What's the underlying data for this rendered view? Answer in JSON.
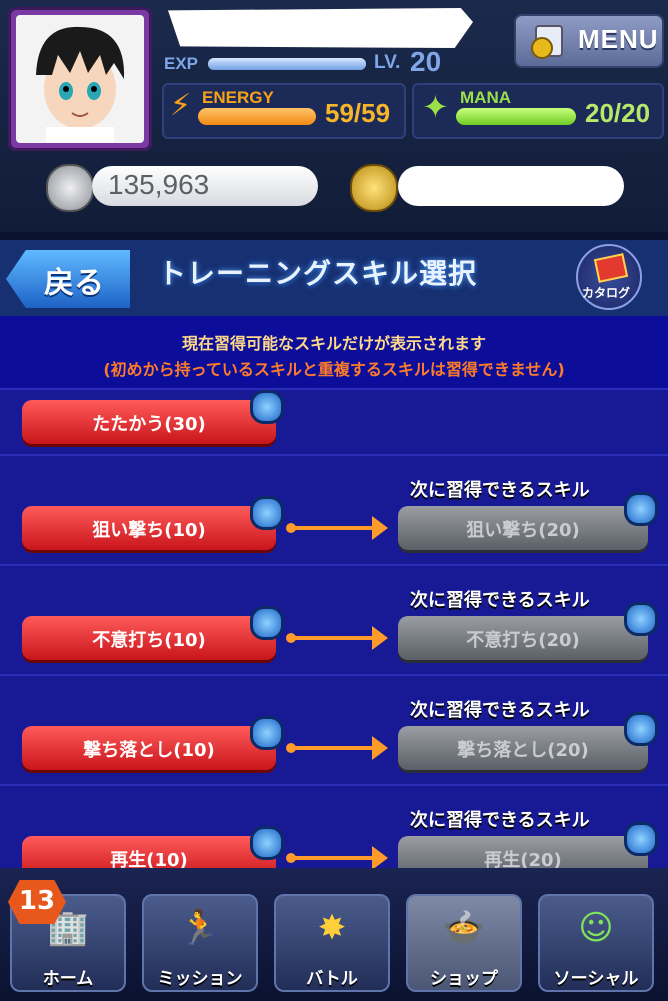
{
  "header": {
    "menu_label": "MENU",
    "exp_label": "EXP",
    "exp_progress": 1.0,
    "lv_label": "LV.",
    "lv_value": "20",
    "energy_label": "ENERGY",
    "energy_value": "59/59",
    "energy_progress": 1.0,
    "mana_label": "MANA",
    "mana_value": "20/20",
    "mana_progress": 1.0,
    "silver_value": "135,963"
  },
  "titlebar": {
    "back_label": "戻る",
    "title": "トレーニングスキル選択",
    "catalog_label": "カタログ"
  },
  "info": {
    "line1": "現在習得可能なスキルだけが表示されます",
    "line2": "(初めから持っているスキルと重複するスキルは習得できません)"
  },
  "skills": [
    {
      "current": "たたかう(30)",
      "next_heading": "",
      "next": ""
    },
    {
      "current": "狙い撃ち(10)",
      "next_heading": "次に習得できるスキル",
      "next": "狙い撃ち(20)"
    },
    {
      "current": "不意打ち(10)",
      "next_heading": "次に習得できるスキル",
      "next": "不意打ち(20)"
    },
    {
      "current": "撃ち落とし(10)",
      "next_heading": "次に習得できるスキル",
      "next": "撃ち落とし(20)"
    },
    {
      "current": "再生(10)",
      "next_heading": "次に習得できるスキル",
      "next": "再生(20)"
    }
  ],
  "nav": {
    "badge": "13",
    "items": [
      {
        "label": "ホーム",
        "icon": "home-icon"
      },
      {
        "label": "ミッション",
        "icon": "mission-icon"
      },
      {
        "label": "バトル",
        "icon": "battle-icon"
      },
      {
        "label": "ショップ",
        "icon": "shop-icon"
      },
      {
        "label": "ソーシャル",
        "icon": "social-icon"
      }
    ]
  }
}
